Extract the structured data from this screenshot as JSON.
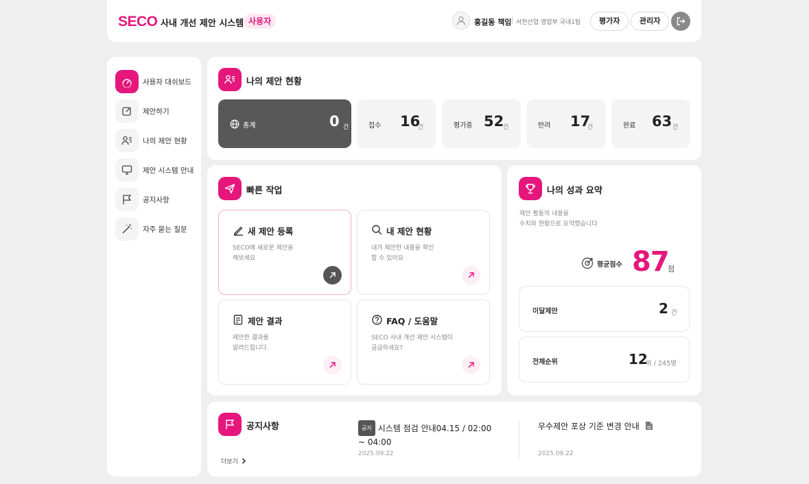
{
  "header": {
    "logo": "SECO",
    "app_title": "사내 개선 제안 시스템",
    "role_badge": "사용자",
    "user_name": "홍길동 책임",
    "user_dept": "서천산업 영업부 국내1팀",
    "btn_evaluator": "평가자",
    "btn_admin": "관리자"
  },
  "sidebar": {
    "items": [
      {
        "label": "사용자 대쉬보드",
        "icon": "dashboard-icon",
        "active": true
      },
      {
        "label": "제안하기",
        "icon": "edit-icon"
      },
      {
        "label": "나의 제안 현황",
        "icon": "user-list-icon"
      },
      {
        "label": "제안 시스템 안내",
        "icon": "monitor-icon"
      },
      {
        "label": "공지사항",
        "icon": "flag-icon"
      },
      {
        "label": "자주 묻는 질문",
        "icon": "magic-wand-icon"
      }
    ]
  },
  "status": {
    "title": "나의 제안 현황",
    "unit": "건",
    "items": [
      {
        "label": "총계",
        "value": "0"
      },
      {
        "label": "접수",
        "value": "16"
      },
      {
        "label": "평가중",
        "value": "52"
      },
      {
        "label": "반려",
        "value": "17"
      },
      {
        "label": "완료",
        "value": "63"
      }
    ]
  },
  "quick": {
    "title": "빠른 작업",
    "cards": [
      {
        "title": "새 제안 등록",
        "desc": "SECO에 새로운 제안을\n해보세요",
        "icon": "pen-icon"
      },
      {
        "title": "내 제안 현황",
        "desc": "내가 제안한 내용을 확인\n할 수 있어요",
        "icon": "search-icon"
      },
      {
        "title": "제안 결과",
        "desc": "제안한 결과를\n알려드립니다.",
        "icon": "document-icon"
      },
      {
        "title": "FAQ / 도움말",
        "desc": "SECO 사내 개선 제안 시스템이\n궁금하세요?",
        "icon": "question-icon"
      }
    ]
  },
  "performance": {
    "title": "나의 성과 요약",
    "desc": "제안 활동의 내용을\n수치와 현황으로 요약했습니다",
    "avg_label": "평균점수",
    "avg_value": "87",
    "avg_unit": "점",
    "monthly_label": "이달제안",
    "monthly_value": "2",
    "monthly_unit": "건",
    "rank_label": "전체순위",
    "rank_value": "12",
    "rank_unit": "위 / 245명"
  },
  "notice": {
    "title": "공지사항",
    "more": "더보기",
    "tag": "공지",
    "items": [
      {
        "title": "시스템 점검 안내04.15 / 02:00 ~ 04:00",
        "date": "2025.09.22"
      },
      {
        "title": "우수제안 포상 기준 변경 안내",
        "date": "2025.09.22"
      }
    ]
  },
  "colors": {
    "accent": "#e5177c",
    "total_bg": "#585858",
    "page_bg": "#efefef"
  }
}
